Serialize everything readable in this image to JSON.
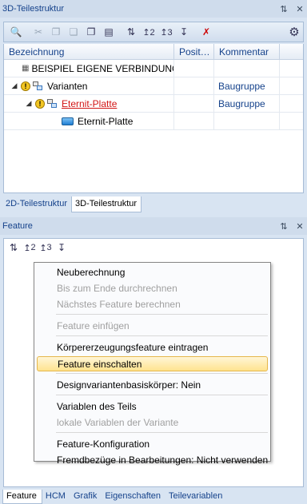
{
  "top_panel": {
    "title": "3D-Teilestruktur",
    "pin_glyph": "&#8645;",
    "close_glyph": "x"
  },
  "toolbar": {
    "buttons": [
      "search-icon",
      "cut-icon",
      "copy-icon",
      "paste-icon",
      "copy2-icon",
      "paste2-icon",
      "level1-icon",
      "level2-icon",
      "level3-icon",
      "expand-icon",
      "delete-icon",
      "settings-icon"
    ]
  },
  "tree": {
    "columns": [
      "Bezeichnung",
      "Posit…",
      "Kommentar",
      ""
    ],
    "rows": [
      {
        "name": "BEISPIEL EIGENE VERBINDUNG",
        "position": "",
        "comment": ""
      },
      {
        "name": "Varianten",
        "position": "",
        "comment": "Baugruppe"
      },
      {
        "name": "Eternit-Platte",
        "position": "",
        "comment": "Baugruppe"
      },
      {
        "name": "Eternit-Platte",
        "position": "",
        "comment": ""
      }
    ]
  },
  "structure_tabs": [
    "2D-Teilestruktur",
    "3D-Teilestruktur"
  ],
  "feature_panel": {
    "title": "Feature",
    "toolbar_labels": [
      "1",
      "2",
      "3",
      ""
    ]
  },
  "context_menu": {
    "items": [
      {
        "label": "Neuberechnung",
        "disabled": false
      },
      {
        "label": "Bis zum Ende durchrechnen",
        "disabled": true
      },
      {
        "label": "Nächstes Feature berechnen",
        "disabled": true
      },
      {
        "label": "Feature einfügen",
        "disabled": true
      },
      {
        "label": "Körpererzeugungsfeature eintragen",
        "disabled": false
      },
      {
        "label": "Feature einschalten",
        "disabled": false,
        "highlighted": true
      },
      {
        "label": "Designvariantenbasiskörper:  Nein",
        "disabled": false
      },
      {
        "label": "Variablen des Teils",
        "disabled": false
      },
      {
        "label": "lokale Variablen der Variante",
        "disabled": true
      },
      {
        "label": "Feature-Konfiguration",
        "disabled": false
      },
      {
        "label": "Fremdbezüge in Bearbeitungen: Nicht verwenden",
        "disabled": false
      }
    ]
  },
  "bottom_tabs": [
    "Feature",
    "HCM",
    "Grafik",
    "Eigenschaften",
    "Teilevariablen"
  ],
  "colors": {
    "accent": "#15428b",
    "highlight": "#ffe38f",
    "link_red": "#d21414"
  }
}
